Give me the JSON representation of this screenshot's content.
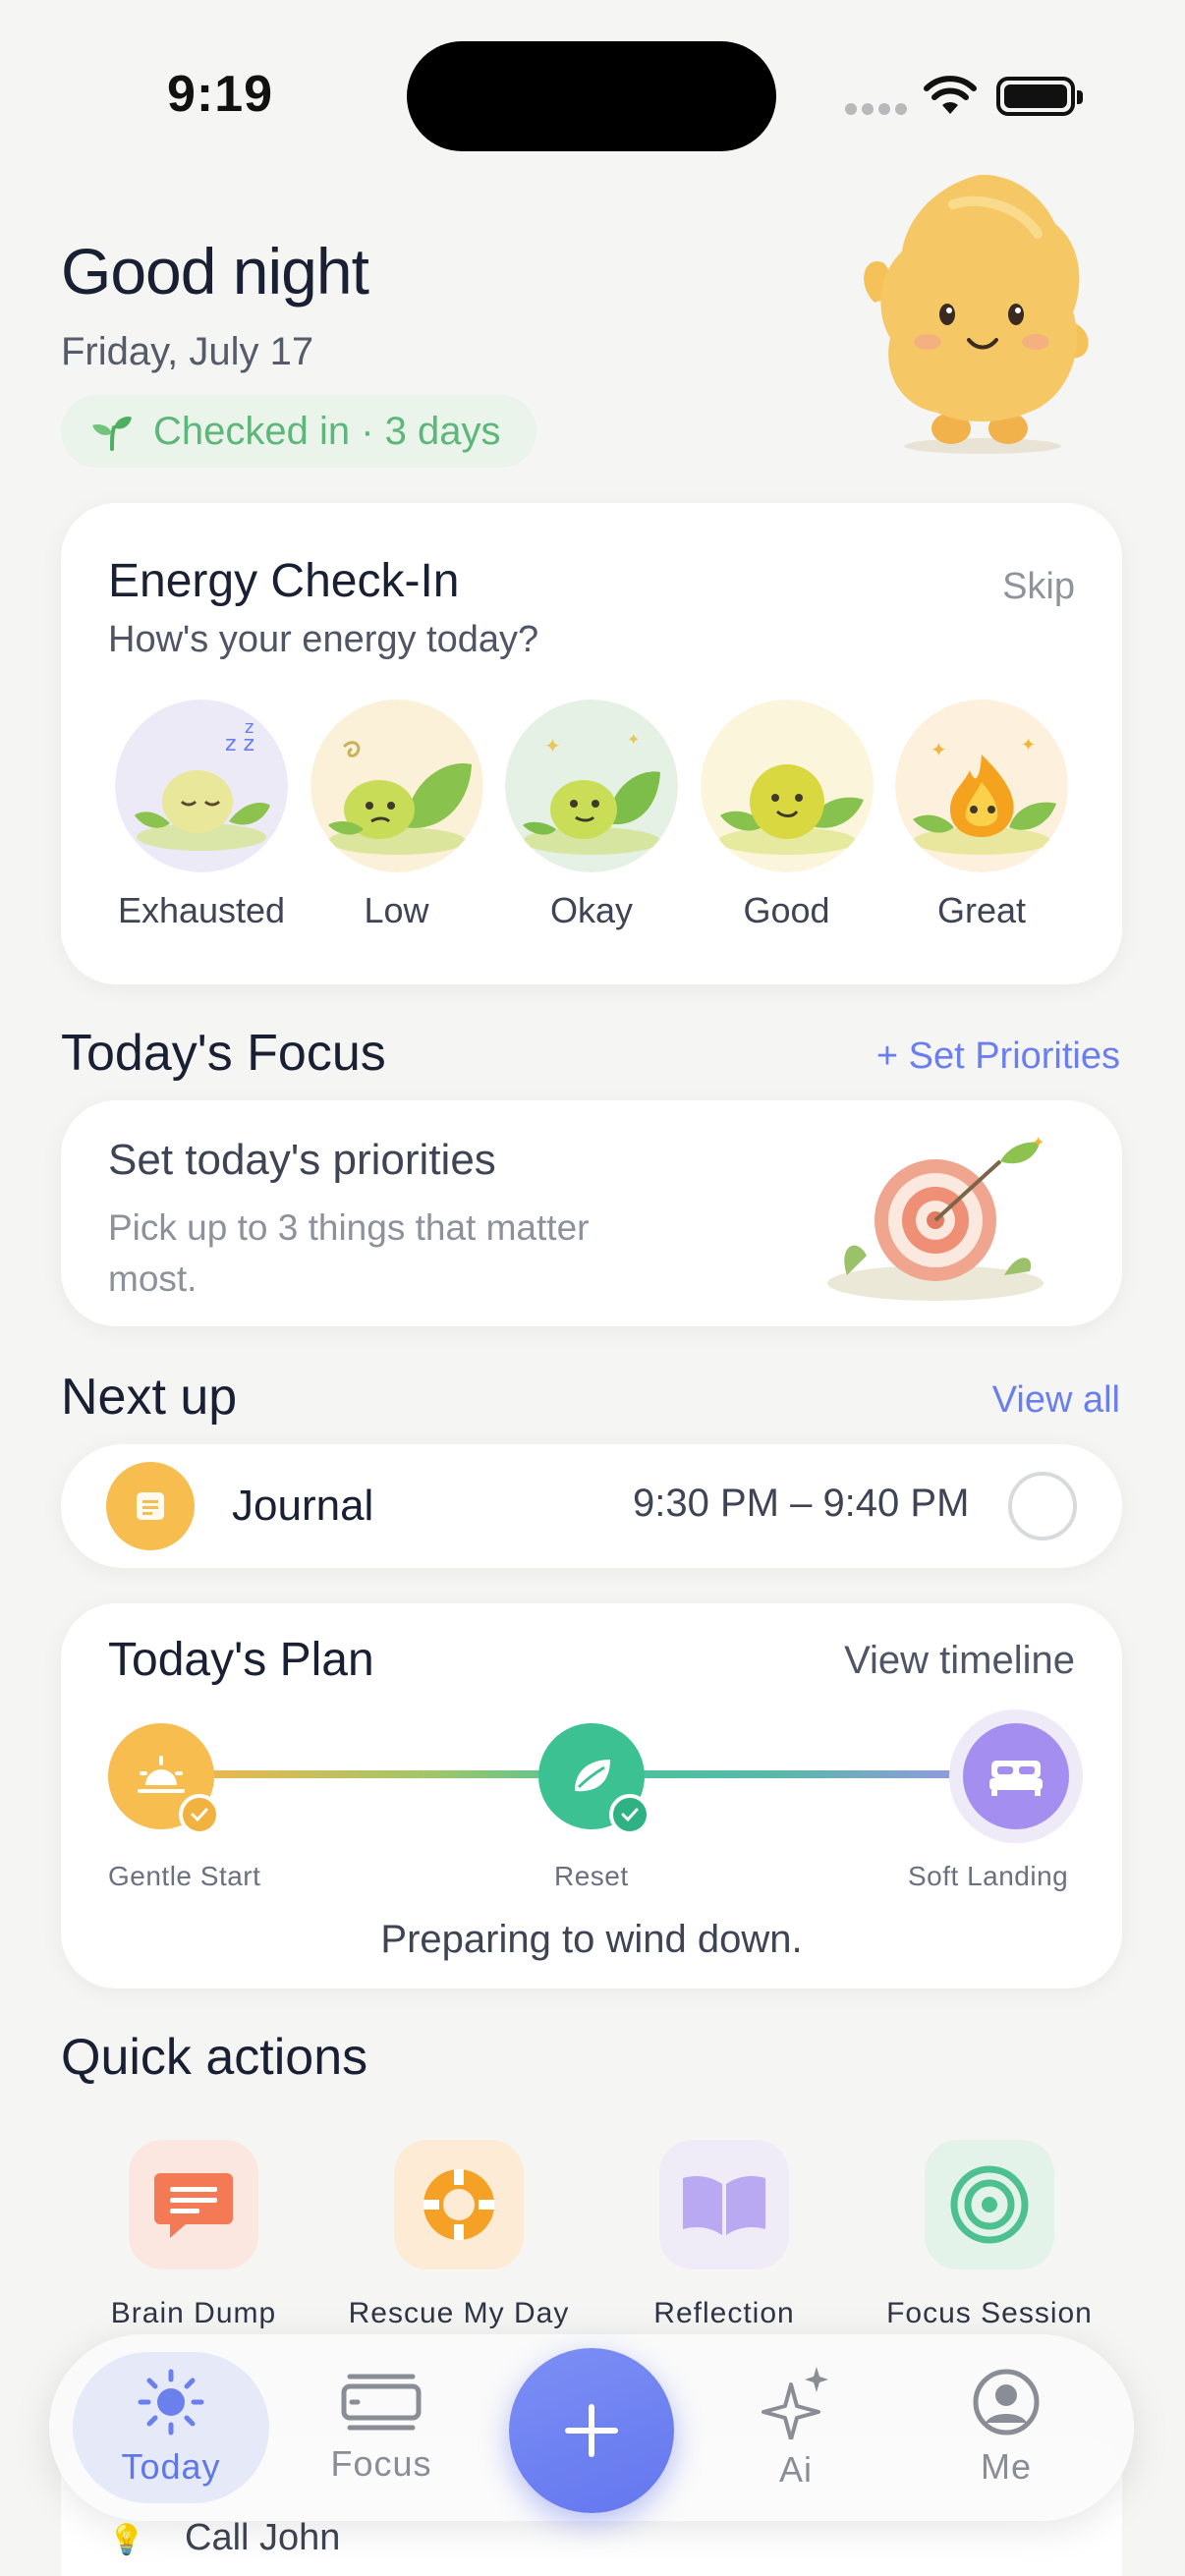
{
  "status_bar": {
    "time": "9:19"
  },
  "header": {
    "greeting": "Good night",
    "date": "Friday, July 17",
    "checkin": "Checked in · 3 days"
  },
  "energy": {
    "title": "Energy Check-In",
    "subtitle": "How's your energy today?",
    "skip": "Skip",
    "options": [
      "Exhausted",
      "Low",
      "Okay",
      "Good",
      "Great"
    ]
  },
  "focus": {
    "section_title": "Today's Focus",
    "set_link": "+ Set Priorities",
    "card_title": "Set today's priorities",
    "card_sub": "Pick up to 3 things that matter most."
  },
  "next_up": {
    "section_title": "Next up",
    "view_all": "View all",
    "item_label": "Journal",
    "item_time": "9:30 PM – 9:40 PM"
  },
  "plan": {
    "title": "Today's Plan",
    "view_timeline": "View timeline",
    "nodes": [
      "Gentle Start",
      "Reset",
      "Soft Landing"
    ],
    "status": "Preparing to wind down."
  },
  "quick_actions": {
    "section_title": "Quick actions",
    "items": [
      "Brain Dump",
      "Rescue My Day",
      "Reflection",
      "Focus Session"
    ]
  },
  "peek": {
    "item": "Call John"
  },
  "tabbar": {
    "tabs": [
      "Today",
      "Focus",
      "Ai",
      "Me"
    ]
  },
  "colors": {
    "accent": "#6b7ef0",
    "green": "#5db77a",
    "journal": "#f8bd4f",
    "reset": "#3cc193",
    "soft_landing": "#a48ff0"
  }
}
